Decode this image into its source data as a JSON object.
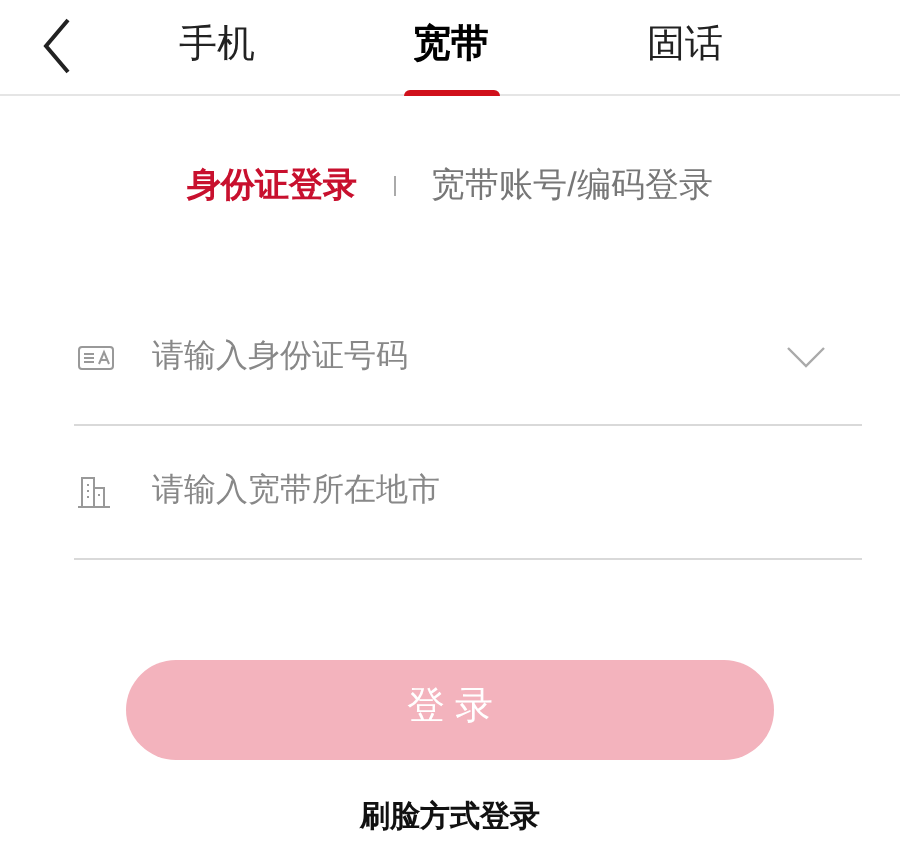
{
  "tabs": [
    {
      "label": "手机",
      "selected": false
    },
    {
      "label": "宽带",
      "selected": true
    },
    {
      "label": "固话",
      "selected": false
    }
  ],
  "login_modes": [
    {
      "label": "身份证登录",
      "selected": true
    },
    {
      "label": "宽带账号/编码登录",
      "selected": false
    }
  ],
  "fields": [
    {
      "kind": "id",
      "placeholder": "请输入身份证号码",
      "dropdown": true
    },
    {
      "kind": "city",
      "placeholder": "请输入宽带所在地市",
      "dropdown": false
    }
  ],
  "login_button": {
    "label": "登 录",
    "disabled": true
  },
  "alt_login": "刷脸方式登录"
}
